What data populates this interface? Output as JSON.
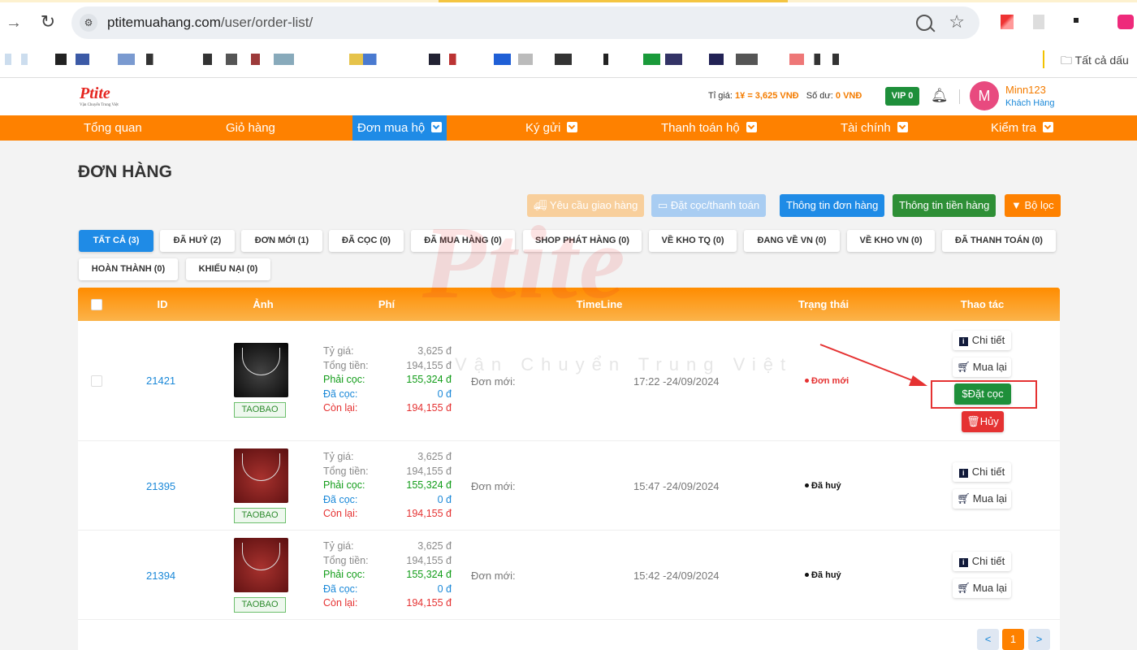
{
  "browser": {
    "url_host": "ptitemuahang.com",
    "url_path": "/user/order-list/",
    "bookmarks_all": "Tất cả dấu"
  },
  "header": {
    "logo": "Ptite",
    "logo_tagline": "Vận Chuyển Trung Việt",
    "rate_label": "Tỉ giá:",
    "rate_value": "1¥ = 3,625 VNĐ",
    "balance_label": "Số dư:",
    "balance_value": "0 VNĐ",
    "vip": "VIP 0",
    "avatar_letter": "M",
    "username": "Minn123",
    "role": "Khách Hàng"
  },
  "menu": [
    "Tổng quan",
    "Giỏ hàng",
    "Đơn mua hộ",
    "Ký gửi",
    "Thanh toán hộ",
    "Tài chính",
    "Kiểm tra"
  ],
  "page_title": "ĐƠN HÀNG",
  "watermark": "Ptite",
  "watermark_sub": "Vận Chuyển Trung Việt",
  "actions": [
    "Yêu cầu giao hàng",
    "Đặt cọc/thanh toán",
    "Thông tin đơn hàng",
    "Thông tin tiền hàng",
    "Bộ lọc"
  ],
  "filter_tabs": [
    "TẤT CẢ  (3)",
    "ĐÃ HUỶ  (2)",
    "ĐƠN MỚI  (1)",
    "ĐÃ CỌC  (0)",
    "ĐÃ MUA HÀNG  (0)",
    "SHOP PHÁT HÀNG  (0)",
    "VỀ KHO TQ  (0)",
    "ĐANG VỀ VN  (0)",
    "VỀ KHO VN  (0)",
    "ĐÃ THANH TOÁN  (0)",
    "HOÀN THÀNH  (0)",
    "KHIẾU NẠI  (0)"
  ],
  "columns": [
    "ID",
    "Ảnh",
    "Phí",
    "TimeLine",
    "Trạng thái",
    "Thao tác"
  ],
  "fee_labels": [
    "Tỷ giá:",
    "Tổng tiền:",
    "Phải cọc:",
    "Đã cọc:",
    "Còn lại:"
  ],
  "orders": [
    {
      "id": "21421",
      "source": "TAOBAO",
      "fees": [
        "3,625 đ",
        "194,155 đ",
        "155,324 đ",
        "0 đ",
        "194,155 đ"
      ],
      "timeline_label": "Đơn mới:",
      "timeline_time": "17:22 -24/09/2024",
      "status": "Đơn mới",
      "btn_detail": "Chi tiết",
      "btn_rebuy": "Mua lại",
      "btn_deposit": "Đặt cọc",
      "btn_cancel": "Hủy"
    },
    {
      "id": "21395",
      "source": "TAOBAO",
      "fees": [
        "3,625 đ",
        "194,155 đ",
        "155,324 đ",
        "0 đ",
        "194,155 đ"
      ],
      "timeline_label": "Đơn mới:",
      "timeline_time": "15:47 -24/09/2024",
      "status": "Đã huỷ",
      "btn_detail": "Chi tiết",
      "btn_rebuy": "Mua lại"
    },
    {
      "id": "21394",
      "source": "TAOBAO",
      "fees": [
        "3,625 đ",
        "194,155 đ",
        "155,324 đ",
        "0 đ",
        "194,155 đ"
      ],
      "timeline_label": "Đơn mới:",
      "timeline_time": "15:42 -24/09/2024",
      "status": "Đã huỷ",
      "btn_detail": "Chi tiết",
      "btn_rebuy": "Mua lại"
    }
  ],
  "pagination": {
    "prev": "<",
    "current": "1",
    "next": ">"
  },
  "colors": {
    "brand_orange": "#fe8100",
    "active_blue": "#1f8be6",
    "deposit_green": "#1e8f3a",
    "cancel_red": "#e53232"
  }
}
